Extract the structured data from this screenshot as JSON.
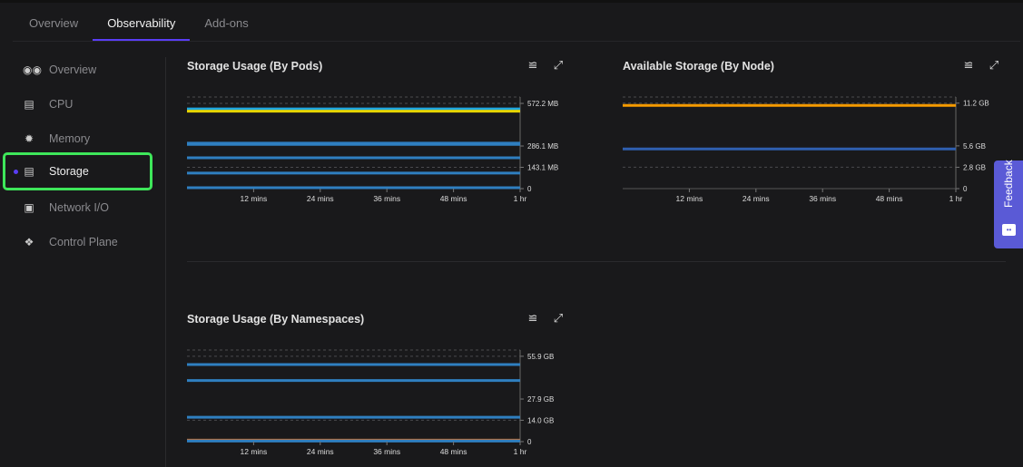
{
  "tabs": [
    {
      "label": "Overview"
    },
    {
      "label": "Observability"
    },
    {
      "label": "Add-ons"
    }
  ],
  "sidebar": {
    "items": [
      {
        "label": "Overview",
        "icon": "binoculars-icon"
      },
      {
        "label": "CPU",
        "icon": "database-icon"
      },
      {
        "label": "Memory",
        "icon": "chip-icon"
      },
      {
        "label": "Storage",
        "icon": "database-icon"
      },
      {
        "label": "Network I/O",
        "icon": "network-icon"
      },
      {
        "label": "Control Plane",
        "icon": "control-plane-icon"
      }
    ]
  },
  "feedback": {
    "label": "Feedback"
  },
  "chart_data": [
    {
      "type": "line",
      "title": "Storage Usage (By Pods)",
      "xticks": [
        "12 mins",
        "24 mins",
        "36 mins",
        "48 mins",
        "1 hr"
      ],
      "yticks": [
        {
          "v": 0,
          "l": "0"
        },
        {
          "v": 143.1,
          "l": "143.1 MB"
        },
        {
          "v": 286.1,
          "l": "286.1 MB"
        },
        {
          "v": 572.2,
          "l": "572.2 MB"
        }
      ],
      "ymax": 615,
      "unit": "MB",
      "series": [
        {
          "color": "#1fa8e0",
          "value": 535
        },
        {
          "color": "#e6d400",
          "value": 520
        },
        {
          "color": "#2f7fc0",
          "value": 305
        },
        {
          "color": "#2f7fc0",
          "value": 297
        },
        {
          "color": "#2f7fc0",
          "value": 207
        },
        {
          "color": "#2f7fc0",
          "value": 104
        },
        {
          "color": "#2f7fc0",
          "value": 6
        }
      ]
    },
    {
      "type": "line",
      "title": "Available Storage (By Node)",
      "xticks": [
        "12 mins",
        "24 mins",
        "36 mins",
        "48 mins",
        "1 hr"
      ],
      "yticks": [
        {
          "v": 0,
          "l": "0"
        },
        {
          "v": 2.8,
          "l": "2.8 GB"
        },
        {
          "v": 5.6,
          "l": "5.6 GB"
        },
        {
          "v": 11.2,
          "l": "11.2 GB"
        }
      ],
      "ymax": 12,
      "unit": "GB",
      "series": [
        {
          "color": "#f59a00",
          "value": 10.9
        },
        {
          "color": "#2f5fb0",
          "value": 5.2
        }
      ]
    },
    {
      "type": "line",
      "title": "Storage Usage (By Namespaces)",
      "xticks": [
        "12 mins",
        "24 mins",
        "36 mins",
        "48 mins",
        "1 hr"
      ],
      "yticks": [
        {
          "v": 0,
          "l": "0"
        },
        {
          "v": 14.0,
          "l": "14.0 GB"
        },
        {
          "v": 27.9,
          "l": "27.9 GB"
        },
        {
          "v": 55.9,
          "l": "55.9 GB"
        }
      ],
      "ymax": 60,
      "unit": "GB",
      "series": [
        {
          "color": "#2f7fc0",
          "value": 50.5
        },
        {
          "color": "#2f7fc0",
          "value": 40
        },
        {
          "color": "#2f7fc0",
          "value": 16
        },
        {
          "color": "#c0703a",
          "value": 1
        },
        {
          "color": "#2f7fc0",
          "value": 0.4
        }
      ]
    }
  ]
}
